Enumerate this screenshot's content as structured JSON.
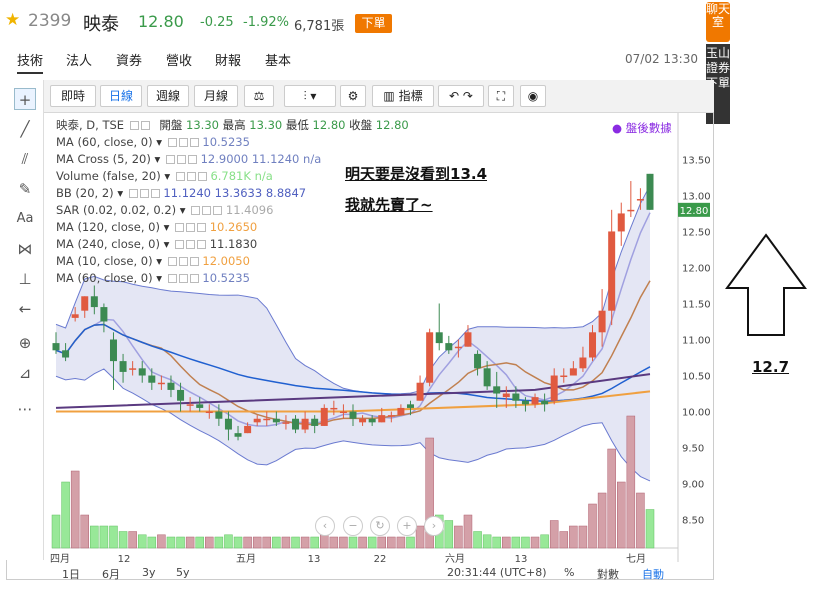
{
  "header": {
    "code": "2399",
    "name": "映泰",
    "price": "12.80",
    "change": "-0.25",
    "pct": "-1.92%",
    "volume": "6,781張",
    "order_label": "下單"
  },
  "tabs": [
    "技術",
    "法人",
    "資券",
    "營收",
    "財報",
    "基本"
  ],
  "date": "07/02 13:30",
  "side": {
    "chat": "聊天室",
    "broker": "玉山證券下單"
  },
  "toolbar": {
    "intraday": "即時",
    "daily": "日線",
    "weekly": "週線",
    "monthly": "月線",
    "indicators": "指標"
  },
  "legend": {
    "title": "映泰, D, TSE",
    "ohlc": [
      "開盤",
      "13.30",
      "最高",
      "13.30",
      "最低",
      "12.80",
      "收盤",
      "12.80"
    ],
    "rows": [
      {
        "label": "MA (60, close, 0)",
        "value": "10.5235",
        "color": "#7080c0"
      },
      {
        "label": "MA Cross (5, 20)",
        "value": "12.9000  11.1240  n/a",
        "color": "#7080c0"
      },
      {
        "label": "Volume (false, 20)",
        "value": "6.781K  n/a",
        "color": "#88e088"
      },
      {
        "label": "BB (20, 2)",
        "value": "11.1240  13.3633  8.8847",
        "color": "#5060c0"
      },
      {
        "label": "SAR (0.02, 0.02, 0.2)",
        "value": "11.4096",
        "color": "#aaa"
      },
      {
        "label": "MA (120, close, 0)",
        "value": "10.2650",
        "color": "#f0a040"
      },
      {
        "label": "MA (240, close, 0)",
        "value": "11.1830",
        "color": "#444"
      },
      {
        "label": "MA (10, close, 0)",
        "value": "12.0050",
        "color": "#f0a040"
      },
      {
        "label": "MA (60, close, 0)",
        "value": "10.5235",
        "color": "#7080c0"
      }
    ],
    "after_hours": "盤後數據"
  },
  "annotation": {
    "line1": "明天要是沒看到13.4",
    "line2": "我就先賣了~",
    "arrow_value": "12.7"
  },
  "price_label": "12.80",
  "bottom": {
    "ranges": [
      "1日",
      "6月",
      "3y",
      "5y"
    ],
    "time": "20:31:44 (UTC+8)",
    "pct": "%",
    "log": "對數",
    "auto": "自動"
  },
  "chart_data": {
    "type": "candlestick",
    "yticks": [
      "13.50",
      "13.00",
      "12.50",
      "12.00",
      "11.50",
      "11.00",
      "10.50",
      "10.00",
      "9.50",
      "9.00",
      "8.50"
    ],
    "xticks": [
      "四月",
      "12",
      "五月",
      "13",
      "22",
      "六月",
      "13",
      "七月"
    ],
    "candles": [
      [
        10.95,
        10.85,
        11.1,
        10.8
      ],
      [
        10.85,
        10.75,
        10.95,
        10.7
      ],
      [
        11.3,
        11.35,
        11.45,
        11.25
      ],
      [
        11.4,
        11.6,
        11.6,
        11.3
      ],
      [
        11.6,
        11.45,
        11.75,
        11.35
      ],
      [
        11.45,
        11.25,
        11.5,
        11.1
      ],
      [
        11.0,
        10.7,
        11.1,
        10.3
      ],
      [
        10.7,
        10.55,
        10.8,
        10.4
      ],
      [
        10.6,
        10.6,
        10.7,
        10.5
      ],
      [
        10.6,
        10.5,
        10.7,
        10.4
      ],
      [
        10.5,
        10.4,
        10.6,
        10.3
      ],
      [
        10.4,
        10.4,
        10.5,
        10.3
      ],
      [
        10.4,
        10.3,
        10.5,
        10.2
      ],
      [
        10.3,
        10.15,
        10.4,
        10.0
      ],
      [
        10.1,
        10.1,
        10.2,
        10.0
      ],
      [
        10.1,
        10.05,
        10.2,
        10.0
      ],
      [
        10.0,
        10.0,
        10.1,
        9.9
      ],
      [
        10.0,
        9.9,
        10.1,
        9.8
      ],
      [
        9.9,
        9.75,
        10.0,
        9.6
      ],
      [
        9.7,
        9.65,
        9.8,
        9.6
      ],
      [
        9.7,
        9.8,
        9.85,
        9.7
      ],
      [
        9.85,
        9.9,
        9.95,
        9.8
      ],
      [
        9.9,
        9.9,
        10.0,
        9.8
      ],
      [
        9.9,
        9.85,
        10.0,
        9.8
      ],
      [
        9.85,
        9.85,
        9.95,
        9.75
      ],
      [
        9.9,
        9.75,
        9.95,
        9.7
      ],
      [
        9.75,
        9.9,
        10.0,
        9.7
      ],
      [
        9.9,
        9.8,
        9.95,
        9.7
      ],
      [
        9.8,
        10.05,
        10.1,
        9.8
      ],
      [
        10.05,
        10.05,
        10.15,
        9.95
      ],
      [
        10.0,
        10.0,
        10.1,
        9.9
      ],
      [
        10.0,
        9.9,
        10.1,
        9.8
      ],
      [
        9.85,
        9.9,
        9.95,
        9.8
      ],
      [
        9.9,
        9.85,
        9.95,
        9.8
      ],
      [
        9.85,
        9.95,
        10.05,
        9.85
      ],
      [
        9.95,
        9.95,
        10.0,
        9.85
      ],
      [
        9.95,
        10.05,
        10.1,
        9.95
      ],
      [
        10.1,
        10.05,
        10.15,
        9.95
      ],
      [
        10.15,
        10.4,
        10.5,
        10.15
      ],
      [
        10.4,
        11.1,
        11.15,
        10.35
      ],
      [
        11.1,
        10.95,
        11.5,
        10.85
      ],
      [
        10.95,
        10.85,
        11.05,
        10.8
      ],
      [
        10.9,
        10.9,
        11.0,
        10.75
      ],
      [
        10.9,
        11.1,
        11.2,
        10.9
      ],
      [
        10.8,
        10.6,
        10.85,
        10.5
      ],
      [
        10.6,
        10.35,
        10.7,
        10.3
      ],
      [
        10.35,
        10.25,
        10.55,
        10.05
      ],
      [
        10.2,
        10.25,
        10.35,
        10.05
      ],
      [
        10.25,
        10.15,
        10.35,
        10.05
      ],
      [
        10.15,
        10.1,
        10.2,
        10.0
      ],
      [
        10.1,
        10.2,
        10.25,
        10.05
      ],
      [
        10.15,
        10.1,
        10.25,
        10.0
      ],
      [
        10.15,
        10.5,
        10.6,
        10.1
      ],
      [
        10.5,
        10.5,
        10.6,
        10.4
      ],
      [
        10.5,
        10.6,
        10.7,
        10.5
      ],
      [
        10.6,
        10.75,
        10.9,
        10.55
      ],
      [
        10.75,
        11.1,
        11.2,
        10.7
      ],
      [
        11.1,
        11.4,
        11.7,
        10.9
      ],
      [
        11.4,
        12.5,
        12.8,
        11.2
      ],
      [
        12.5,
        12.75,
        12.9,
        12.3
      ],
      [
        12.8,
        12.8,
        13.2,
        12.7
      ],
      [
        12.95,
        12.95,
        13.1,
        12.8
      ],
      [
        13.3,
        12.8,
        13.3,
        12.8
      ]
    ],
    "volume": [
      0.3,
      0.6,
      0.7,
      0.3,
      0.2,
      0.2,
      0.2,
      0.15,
      0.15,
      0.12,
      0.1,
      0.12,
      0.1,
      0.1,
      0.1,
      0.1,
      0.1,
      0.1,
      0.12,
      0.1,
      0.1,
      0.1,
      0.1,
      0.1,
      0.1,
      0.1,
      0.1,
      0.1,
      0.12,
      0.1,
      0.1,
      0.1,
      0.1,
      0.1,
      0.1,
      0.1,
      0.1,
      0.1,
      0.2,
      1.0,
      0.3,
      0.25,
      0.2,
      0.3,
      0.15,
      0.12,
      0.1,
      0.1,
      0.1,
      0.1,
      0.1,
      0.12,
      0.25,
      0.15,
      0.2,
      0.2,
      0.4,
      0.5,
      0.9,
      0.6,
      1.2,
      0.5,
      0.35
    ]
  }
}
